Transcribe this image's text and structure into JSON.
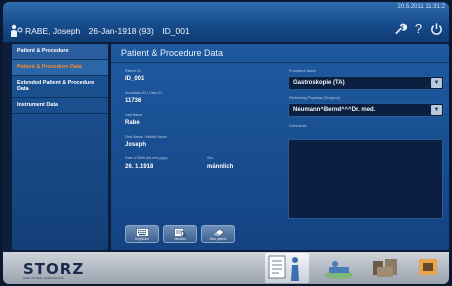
{
  "header": {
    "datetime": "20.5.2011 11:31:2",
    "patient_name": "RABE, Joseph",
    "birth": "26-Jan-1918 (93)",
    "patient_id": "ID_001"
  },
  "sidebar": {
    "items": [
      {
        "label": "Patient & Procedure"
      },
      {
        "label": "Patient & Procedure Data"
      },
      {
        "label": "Extended Patient & Procedure Data"
      },
      {
        "label": "Instrument Data"
      }
    ]
  },
  "main": {
    "title": "Patient & Procedure Data",
    "fields": {
      "patient_id": {
        "label": "Patient ID",
        "value": "ID_001"
      },
      "accession": {
        "label": "Accession ID / Case ID",
        "value": "11736"
      },
      "last_name": {
        "label": "Last Name",
        "value": "Rabe"
      },
      "first_name": {
        "label": "First Name / Middle Name",
        "value": "Joseph"
      },
      "dob": {
        "label": "Date of Birth (dd.mm.yyyy)",
        "value": "26. 1.1918"
      },
      "sex": {
        "label": "Sex",
        "value": "männlich"
      },
      "procedure": {
        "label": "Procedure Name",
        "value": "Gastroskopie (TA)"
      },
      "physician": {
        "label": "Performing Physician (Surgeon)",
        "value": "Neumann^Bernd^^^Dr. med."
      },
      "comments": {
        "label": "Comments",
        "value": ""
      }
    },
    "actions": [
      {
        "label": "Keyboard",
        "icon": "keyboard-icon"
      },
      {
        "label": "Worklist",
        "icon": "worklist-icon"
      },
      {
        "label": "New patient",
        "icon": "eraser-icon"
      }
    ]
  },
  "footer": {
    "logo": "STORZ",
    "logo_sub": "KARL STORZ—ENDOSKOPE"
  },
  "colors": {
    "accent_active": "#ff8a2a",
    "panel": "#1e5aa0",
    "field_bg": "#0b1f41"
  }
}
